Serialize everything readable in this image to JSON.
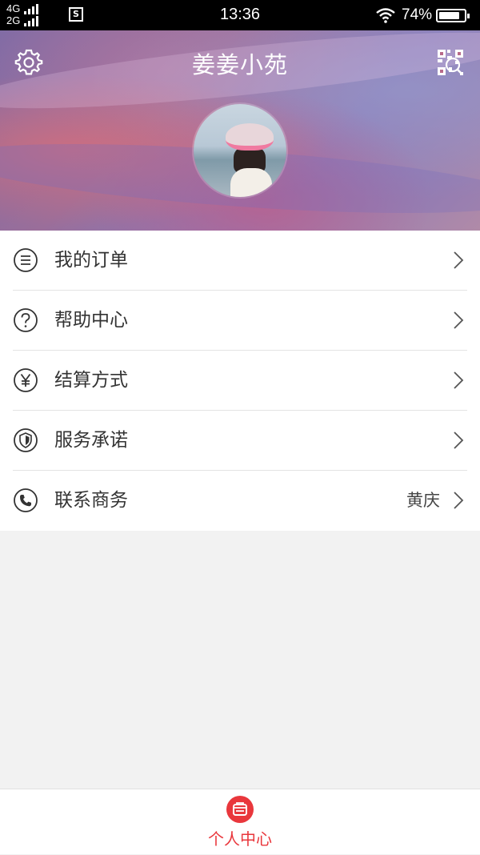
{
  "status_bar": {
    "network_top": "4G",
    "network_bottom": "2G",
    "time": "13:36",
    "battery": "74%",
    "battery_level": 0.74
  },
  "header": {
    "title": "姜姜小苑",
    "settings_icon": "gear-icon",
    "scan_icon": "qr-scan-icon"
  },
  "menu": {
    "items": [
      {
        "label": "我的订单",
        "icon": "list-icon",
        "value": ""
      },
      {
        "label": "帮助中心",
        "icon": "question-icon",
        "value": ""
      },
      {
        "label": "结算方式",
        "icon": "yen-icon",
        "value": ""
      },
      {
        "label": "服务承诺",
        "icon": "shield-icon",
        "value": ""
      },
      {
        "label": "联系商务",
        "icon": "phone-icon",
        "value": "黄庆"
      }
    ]
  },
  "bottom_nav": {
    "tabs": [
      {
        "label": "个人中心",
        "active": true
      }
    ]
  },
  "colors": {
    "accent": "#e9373c",
    "background": "#f2f2f2"
  }
}
